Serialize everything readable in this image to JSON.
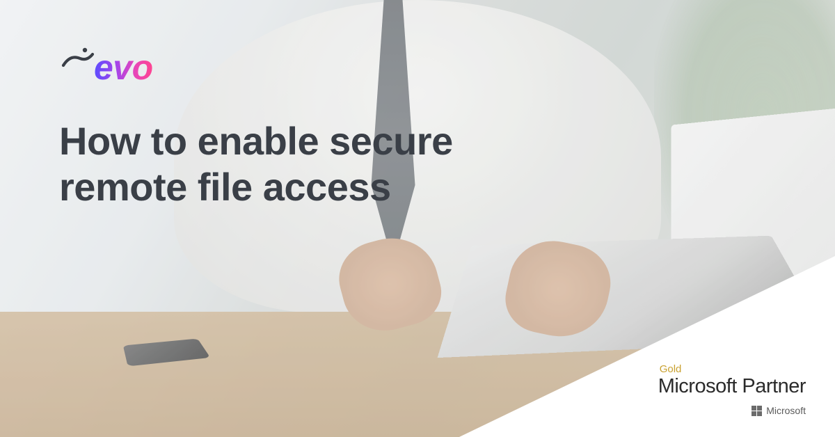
{
  "brand": {
    "logo_text": "evo"
  },
  "headline": {
    "line1": "How to enable secure",
    "line2": "remote file access"
  },
  "partner_badge": {
    "tier": "Gold",
    "program": "Microsoft Partner",
    "brand_name": "Microsoft"
  }
}
